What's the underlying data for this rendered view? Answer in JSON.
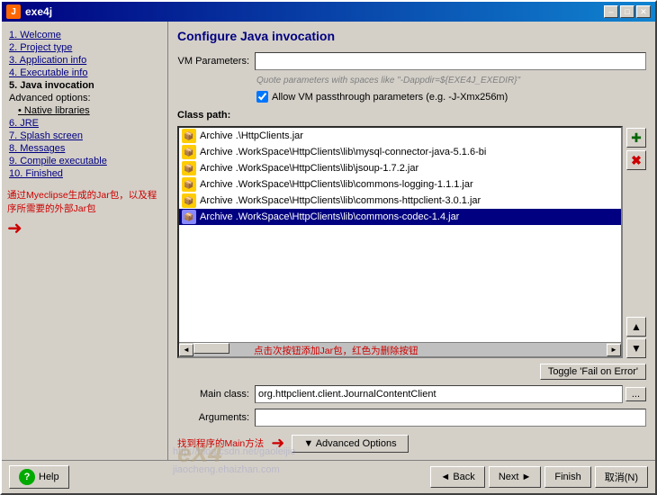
{
  "window": {
    "title": "exe4j",
    "icon": "J"
  },
  "titlebar": {
    "buttons": {
      "minimize": "–",
      "maximize": "□",
      "close": "✕"
    }
  },
  "sidebar": {
    "items": [
      {
        "label": "1.  Welcome",
        "state": "link"
      },
      {
        "label": "2.  Project type",
        "state": "link"
      },
      {
        "label": "3.  Application info",
        "state": "link"
      },
      {
        "label": "4.  Executable info",
        "state": "link"
      },
      {
        "label": "5.  Java invocation",
        "state": "active"
      },
      {
        "label": "Advanced options:",
        "state": "plain"
      },
      {
        "label": "• Native libraries",
        "state": "sub"
      },
      {
        "label": "6.  JRE",
        "state": "link"
      },
      {
        "label": "7.  Splash screen",
        "state": "link"
      },
      {
        "label": "8.  Messages",
        "state": "link"
      },
      {
        "label": "9.  Compile executable",
        "state": "link"
      },
      {
        "label": "10. Finished",
        "state": "link"
      }
    ],
    "annotation1": "通过Myeclipse生成的Jar包，以及程序所需要的外部Jar包",
    "annotation2": "找到程序的Main方法"
  },
  "panel": {
    "title": "Configure Java invocation",
    "vm_parameters_label": "VM Parameters:",
    "vm_parameters_value": "",
    "vm_hint": "Quote parameters with spaces like \"-Dappdir=${EXE4J_EXEDIR}\"",
    "vm_passthrough_label": "Allow VM passthrough parameters (e.g. -J-Xmx256m)",
    "classpath_label": "Class path:",
    "classpath_items": [
      {
        "text": "Archive .\\HttpClients.jar",
        "selected": false
      },
      {
        "text": "Archive .WorkSpace\\HttpClients\\lib\\mysql-connector-java-5.1.6-bi",
        "selected": false
      },
      {
        "text": "Archive .WorkSpace\\HttpClients\\lib\\jsoup-1.7.2.jar",
        "selected": false
      },
      {
        "text": "Archive .WorkSpace\\HttpClients\\lib\\commons-logging-1.1.1.jar",
        "selected": false
      },
      {
        "text": "Archive .WorkSpace\\HttpClients\\lib\\commons-httpclient-3.0.1.jar",
        "selected": false
      },
      {
        "text": "Archive .WorkSpace\\HttpClients\\lib\\commons-codec-1.4.jar",
        "selected": true
      }
    ],
    "toggle_btn_label": "Toggle 'Fail on Error'",
    "main_class_label": "Main class:",
    "main_class_value": "org.httpclient.client.JournalContentClient",
    "main_class_btn": "...",
    "arguments_label": "Arguments:",
    "arguments_value": "",
    "advanced_options_btn": "▼  Advanced Options",
    "annotation_classpath": "点击次按钮添加Jar包，红色为删除按钮"
  },
  "footer": {
    "help_label": "Help",
    "back_label": "◄  Back",
    "next_label": "Next  ►",
    "finish_label": "Finish",
    "cancel_label": "取消(N)"
  },
  "watermark": {
    "url": "http://blog.csdn.net/gaoleijie",
    "site": "jiaocheng.ehaizhan.com"
  },
  "icons": {
    "add": "✚",
    "remove": "✖",
    "up": "▲",
    "down": "▼",
    "folder": "📁",
    "arrow_up": "↑",
    "arrow_down": "↓"
  }
}
